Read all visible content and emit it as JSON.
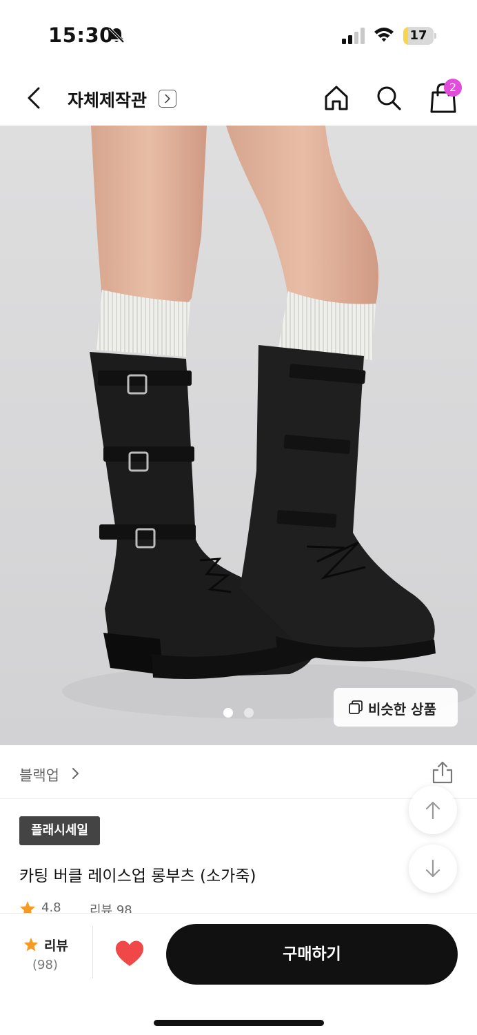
{
  "status_bar": {
    "time": "15:30",
    "battery_percent": "17",
    "battery_level": 0.17,
    "icons": [
      "bell-off-icon",
      "signal-icon",
      "wifi-icon",
      "battery-icon"
    ]
  },
  "header": {
    "title": "자체제작관",
    "cart_count": "2",
    "icons": [
      "back-arrow-icon",
      "chevron-right-icon",
      "home-icon",
      "search-icon",
      "shopping-bag-icon"
    ]
  },
  "gallery": {
    "similar_label": "비슷한 상품",
    "current_slide": 1,
    "total_slides": 2
  },
  "brand": {
    "name": "블랙업"
  },
  "product": {
    "badge": "플래시세일",
    "title": "카팅 버클 레이스업 롱부츠 (소가죽)",
    "rating": "4.8",
    "review_text": "리뷰 98"
  },
  "bottom_bar": {
    "review_label": "리뷰",
    "review_count": "(98)",
    "buy_label": "구매하기"
  },
  "colors": {
    "accent_badge": "#e14cdb",
    "heart": "#f04848",
    "star": "#f59a23",
    "buy_button": "#111111",
    "flash_badge": "#444444"
  }
}
